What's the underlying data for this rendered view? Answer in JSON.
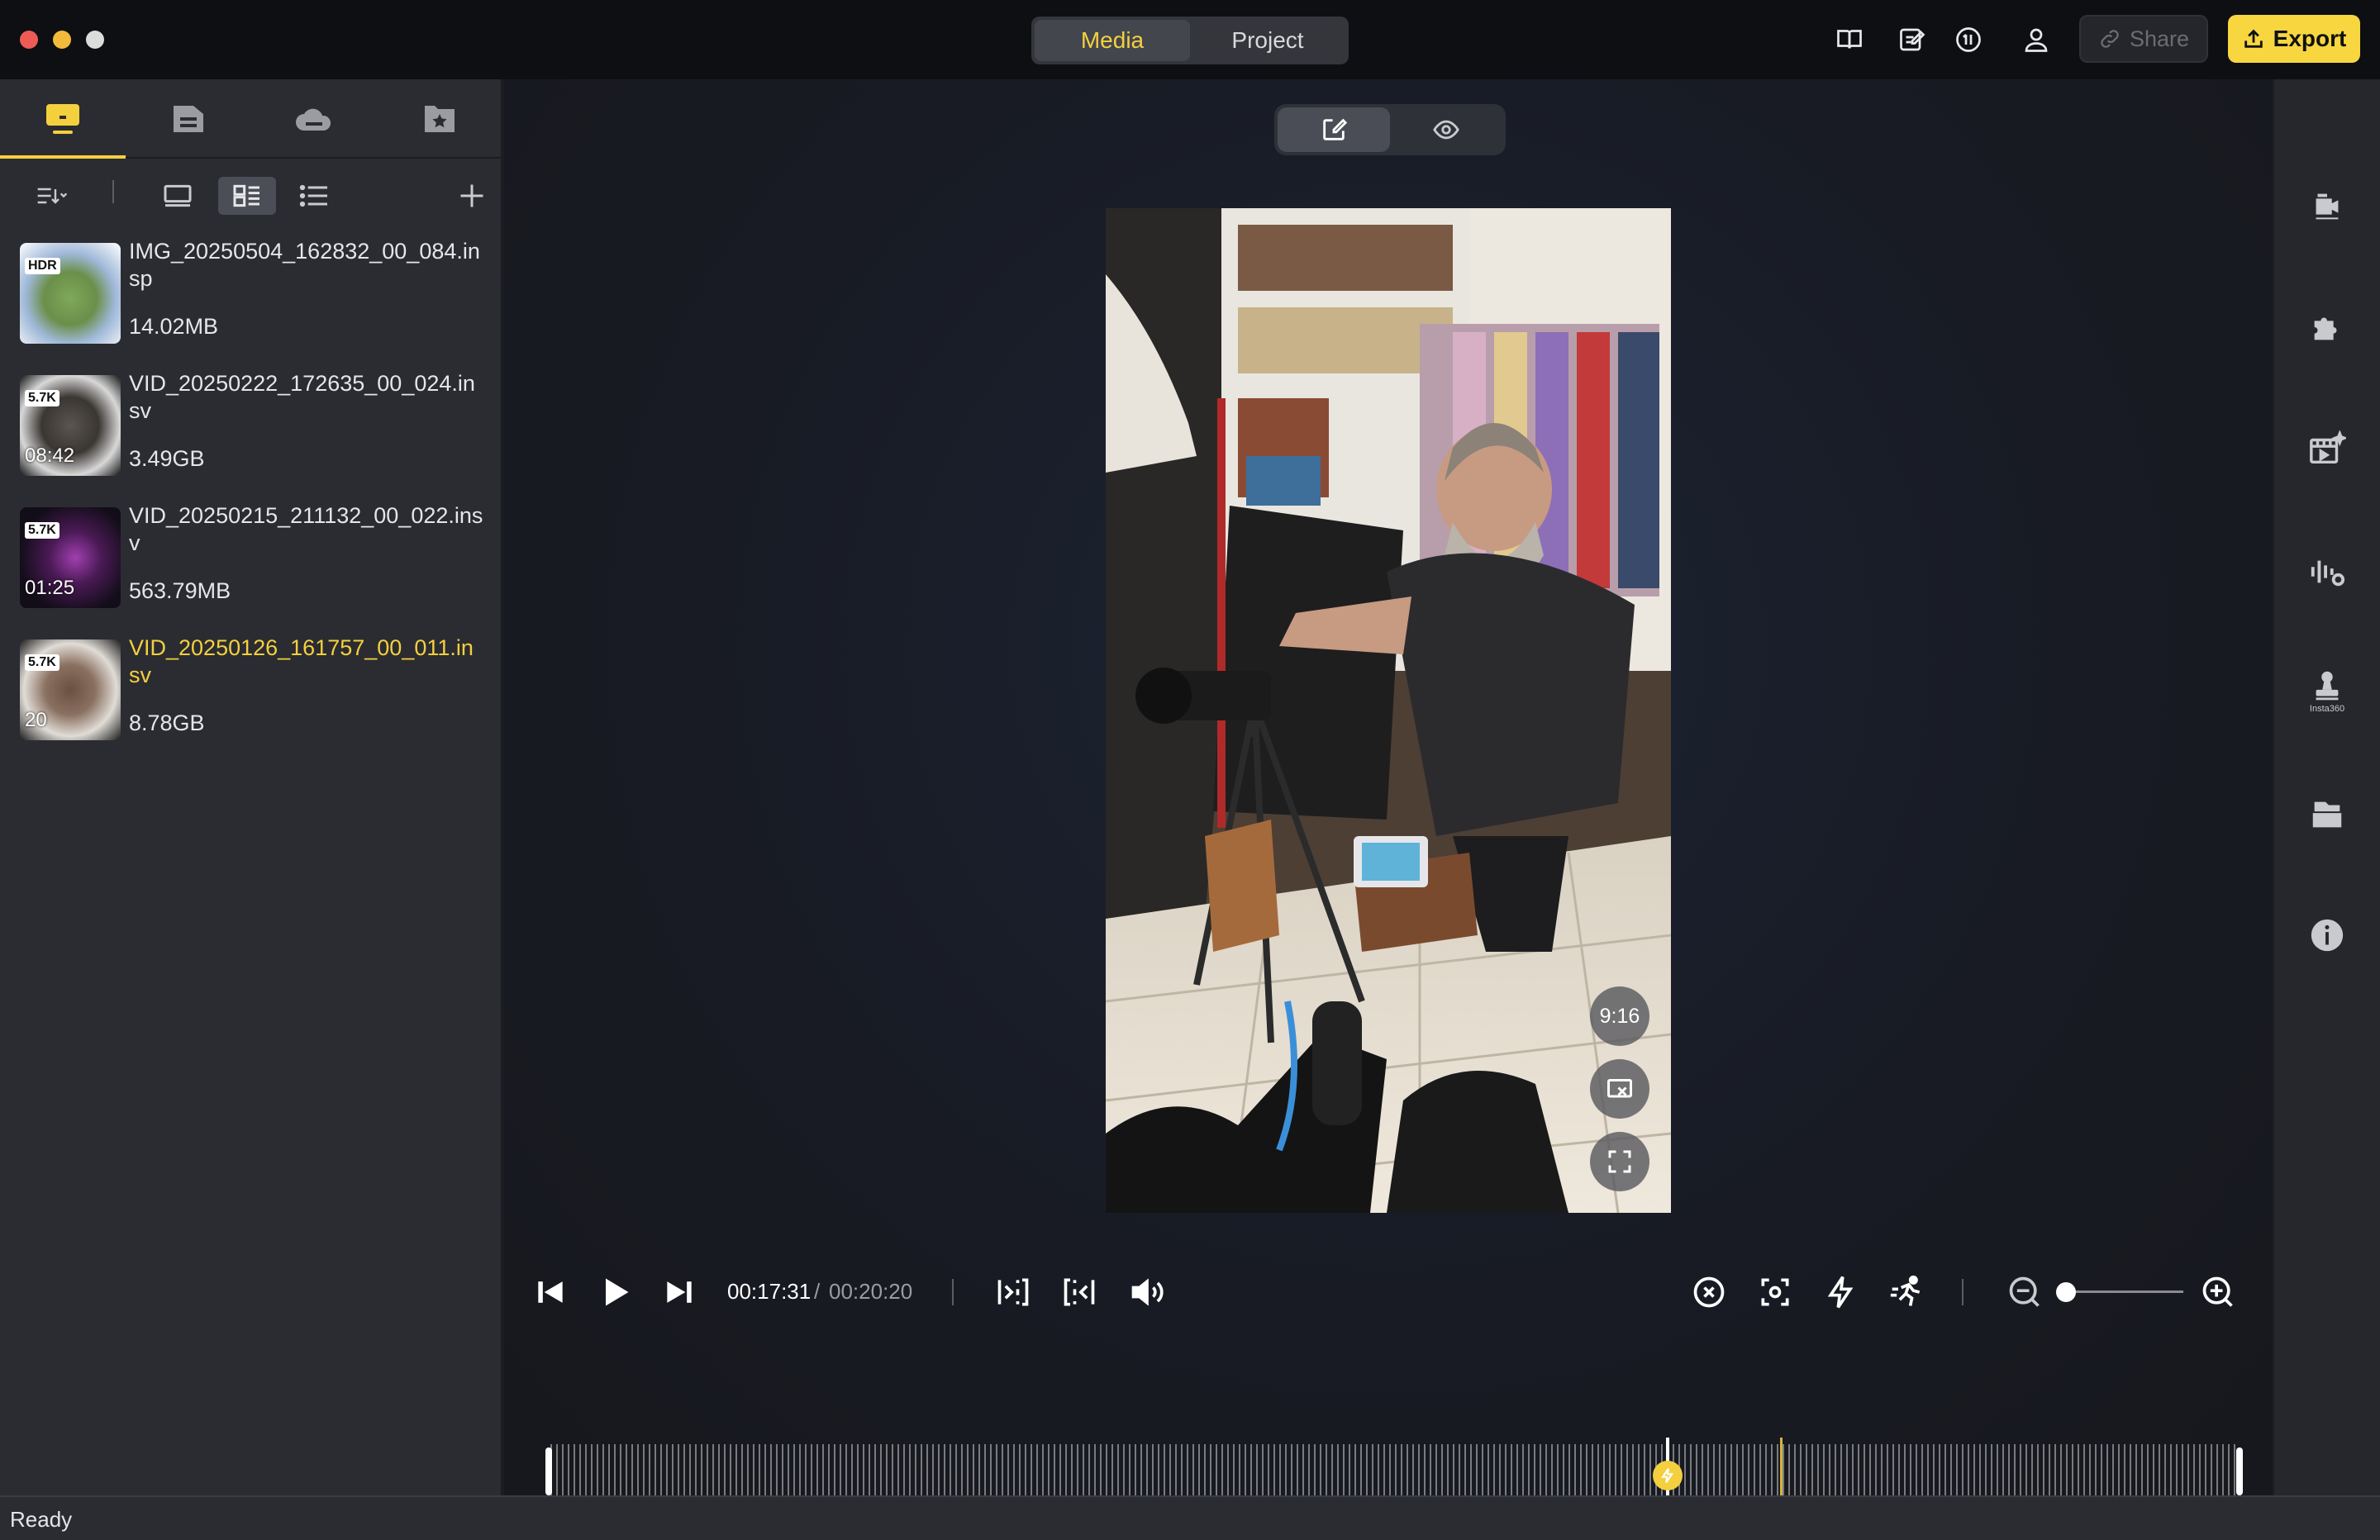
{
  "titlebar": {
    "mode_tabs": [
      "Media",
      "Project"
    ],
    "active_mode": "Media",
    "share_label": "Share",
    "export_label": "Export",
    "accent": "#f4d03f"
  },
  "left_panel": {
    "source_tabs": [
      "local-computer-icon",
      "folder-icon",
      "cloud-icon",
      "favorites-icon"
    ],
    "view_toolbar": [
      "sort-icon",
      "large-thumbnail-icon",
      "grid-view-icon",
      "list-view-icon",
      "add-icon"
    ],
    "media": [
      {
        "name": "IMG_20250504_162832_00_084.insp",
        "size": "14.02MB",
        "badge": "HDR",
        "duration": ""
      },
      {
        "name": "VID_20250222_172635_00_024.insv",
        "size": "3.49GB",
        "badge": "5.7K",
        "duration": "08:42"
      },
      {
        "name": "VID_20250215_211132_00_022.insv",
        "size": "563.79MB",
        "badge": "5.7K",
        "duration": "01:25"
      },
      {
        "name": "VID_20250126_161757_00_011.insv",
        "size": "8.78GB",
        "badge": "5.7K",
        "duration": "20",
        "selected": true
      }
    ]
  },
  "preview": {
    "aspect_label": "9:16",
    "time_current": "00:17:31",
    "time_separator": "/",
    "time_total": "00:20:20"
  },
  "status": {
    "text": "Ready"
  }
}
